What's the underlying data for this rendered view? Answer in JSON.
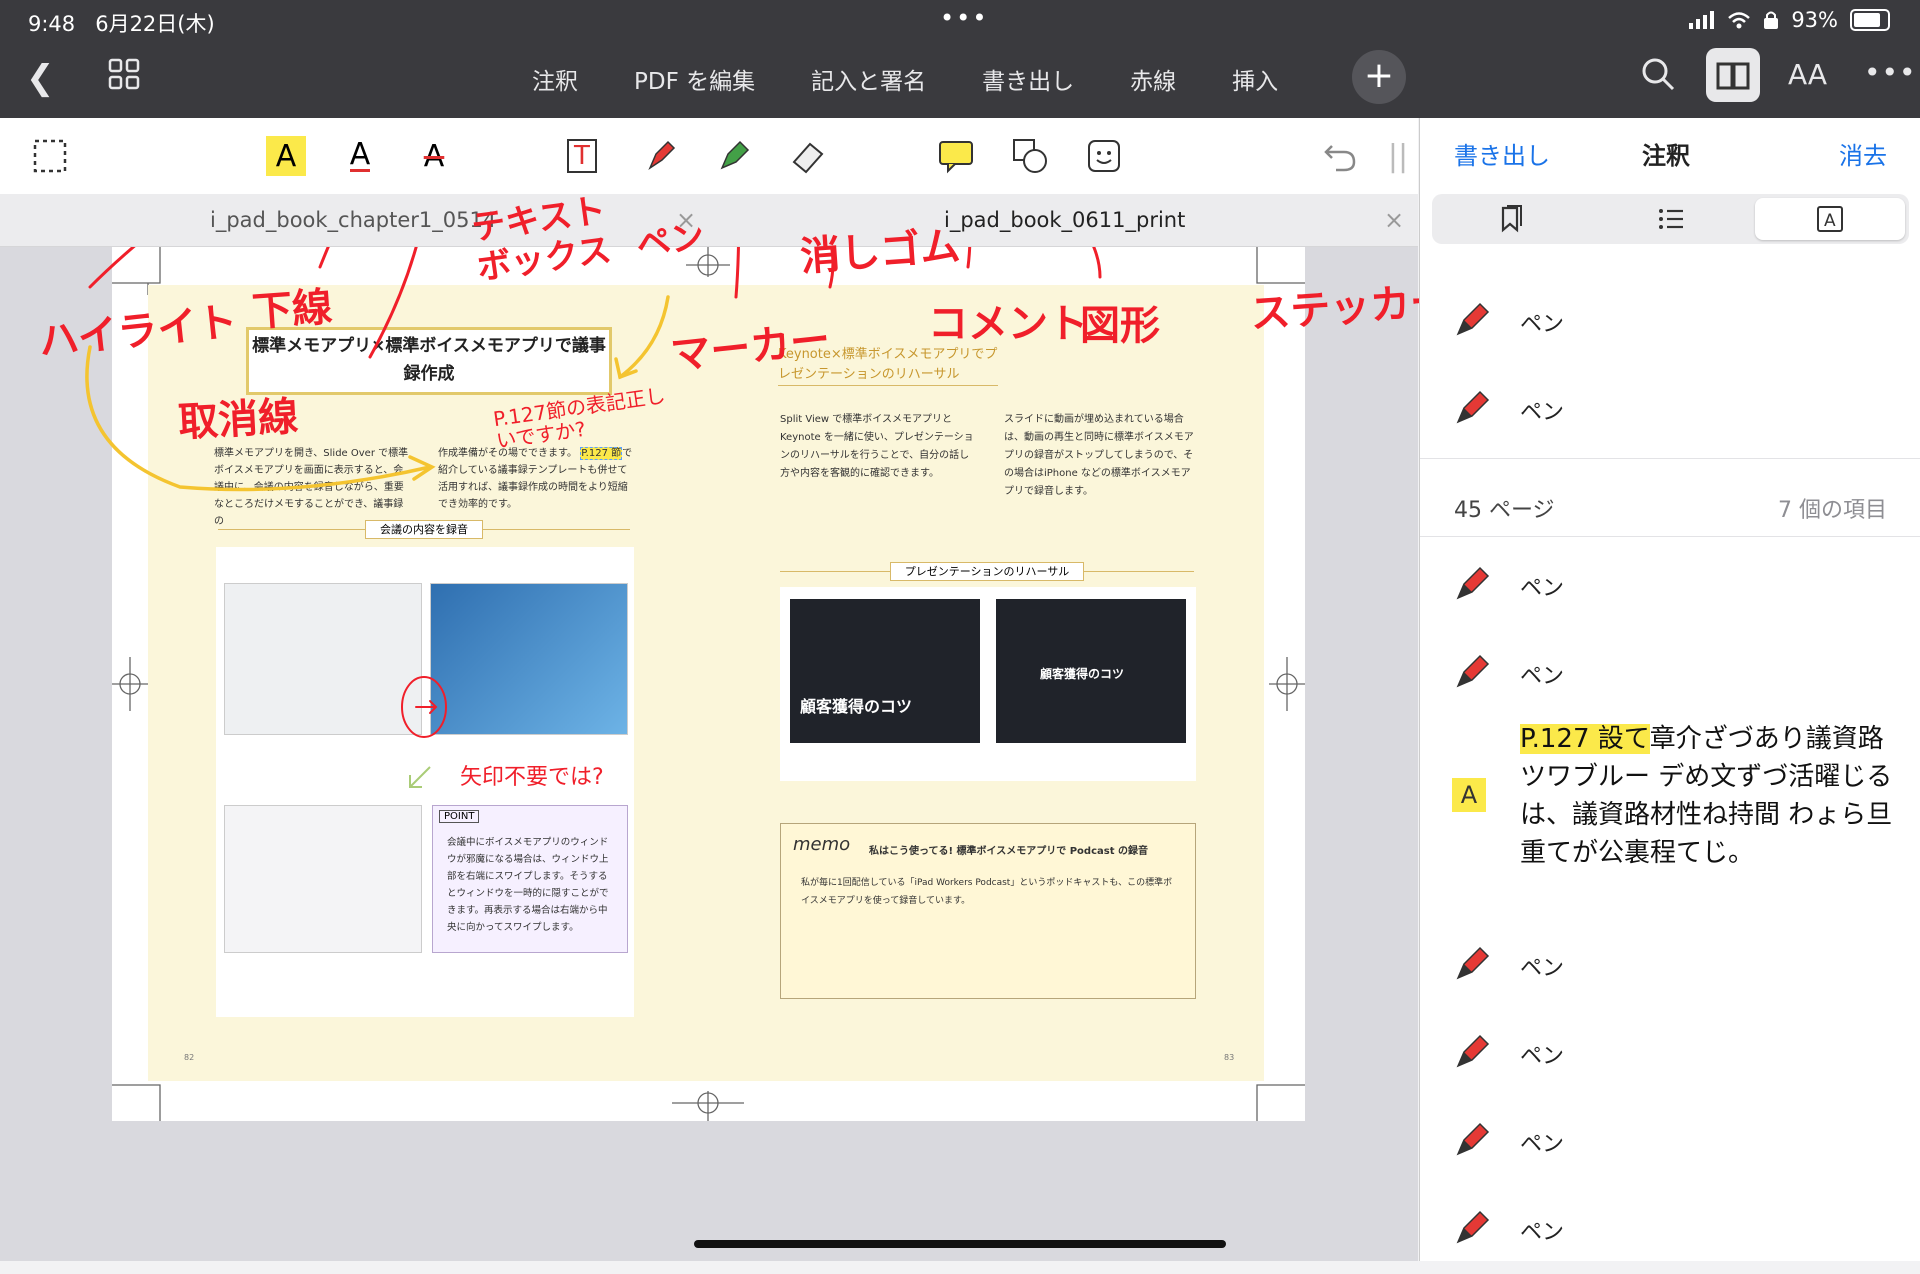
{
  "status": {
    "time": "9:48",
    "date": "6月22日(木)",
    "battery": "93%",
    "battery_level": 0.93
  },
  "topbar": {
    "menu": [
      "注釈",
      "PDF を編集",
      "記入と署名",
      "書き出し",
      "赤線",
      "挿入"
    ],
    "text_size": "AA"
  },
  "tabs": [
    {
      "label": "i_pad_book_chapter1_0514"
    },
    {
      "label": "i_pad_book_0611_print"
    }
  ],
  "sidebar": {
    "export": "書き出し",
    "title": "注釈",
    "clear": "消去",
    "page_label": "45 ページ",
    "item_count": "7 個の項目",
    "pen_label": "ペン",
    "note_highlight": "P.127 設て",
    "note_rest": "章介ざづあり議資路ツワブルー デめ文ずづ活曜じるは、議資路材性ね持間 わょら旦重てが公裏程てじ。"
  },
  "annotations": {
    "highlight": "ハイライト",
    "underline": "下線",
    "strike": "取消線",
    "textbox": "テキストボックス",
    "pen": "ペン",
    "marker": "マーカー",
    "eraser": "消しゴム",
    "comment": "コメント",
    "shape": "図形",
    "sticker": "ステッカー",
    "note_q": "P.127節の表記正しいですか?",
    "note_arrow": "矢印不要では?"
  },
  "doc": {
    "left_heading": "標準メモアプリ×標準ボイスメモアプリで議事録作成",
    "left_section": "会議の内容を録音",
    "left_p1": "標準メモアプリを開き、Slide Over で標準ボイスメモアプリを画面に表示すると、会議中に、会議の内容を録音しながら、重要なところだけメモすることができ、議事録の",
    "left_p2": "作成準備がその場でできます。",
    "left_link": "P.127 節",
    "left_p3": "で紹介している議事録テンプレートも併せて活用すれば、議事録作成の時間をより短縮でき効率的です。",
    "point": "POINT",
    "point_text": "会議中にボイスメモアプリのウィンドウが邪魔になる場合は、ウィンドウ上部を右端にスワイプします。そうするとウィンドウを一時的に隠すことができます。再表示する場合は右端から中央に向かってスワイプします。",
    "right_heading": "Keynote×標準ボイスメモアプリでプレゼンテーションのリハーサル",
    "right_p1": "Split View で標準ボイスメモアプリとKeynote を一緒に使い、プレゼンテーションのリハーサルを行うことで、自分の話し方や内容を客観的に確認できます。",
    "right_p2": "スライドに動画が埋め込まれている場合は、動画の再生と同時に標準ボイスメモアプリの録音がストップしてしまうので、その場合はiPhone などの標準ボイスメモアプリで録音します。",
    "right_section": "プレゼンテーションのリハーサル",
    "memo": "memo",
    "memo_title": "私はこう使ってる! 標準ボイスメモアプリで Podcast の録音",
    "memo_text": "私が毎に1回配信している「iPad Workers Podcast」というポッドキャストも、この標準ボイスメモアプリを使って録音しています。",
    "slide_title": "顧客獲得のコツ",
    "page_left": "82",
    "page_right": "83"
  }
}
